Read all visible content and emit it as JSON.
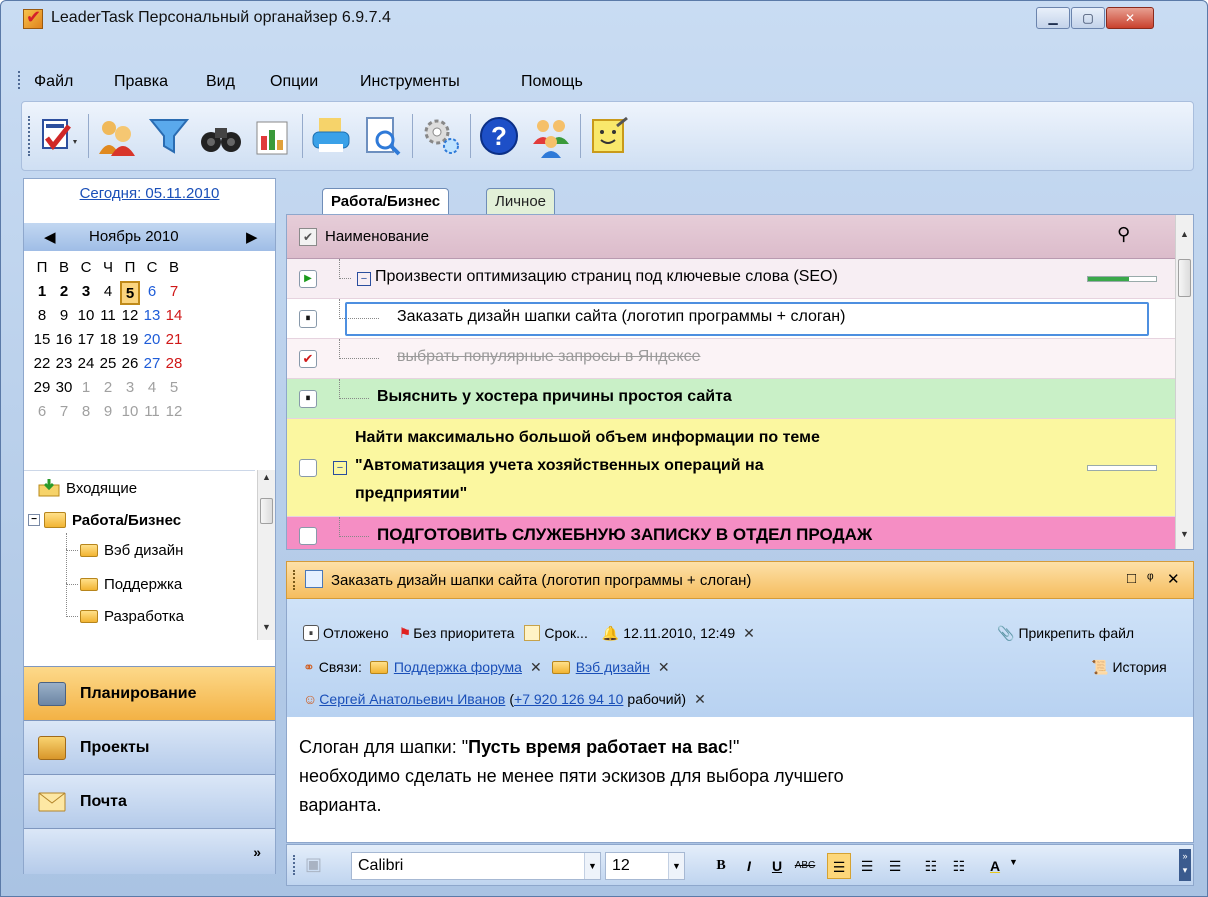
{
  "window": {
    "title": "LeaderTask Персональный органайзер 6.9.7.4"
  },
  "menu": [
    "Файл",
    "Правка",
    "Вид",
    "Опции",
    "Инструменты",
    "Помощь"
  ],
  "toolbar": {
    "icons": [
      "add-task-icon",
      "contacts-icon",
      "filter-icon",
      "binoculars-icon",
      "report-icon",
      "print-icon",
      "preview-icon",
      "settings-icon",
      "help-icon",
      "people-icon",
      "notes-icon"
    ]
  },
  "calendar": {
    "today_link": "Сегодня: 05.11.2010",
    "month": "Ноябрь 2010",
    "weekdays": [
      "П",
      "В",
      "С",
      "Ч",
      "П",
      "С",
      "В"
    ],
    "weeks": [
      [
        "1",
        "2",
        "3",
        "4",
        "5",
        "6",
        "7"
      ],
      [
        "8",
        "9",
        "10",
        "11",
        "12",
        "13",
        "14"
      ],
      [
        "15",
        "16",
        "17",
        "18",
        "19",
        "20",
        "21"
      ],
      [
        "22",
        "23",
        "24",
        "25",
        "26",
        "27",
        "28"
      ],
      [
        "29",
        "30",
        "1",
        "2",
        "3",
        "4",
        "5"
      ],
      [
        "6",
        "7",
        "8",
        "9",
        "10",
        "11",
        "12"
      ]
    ]
  },
  "folders": {
    "inbox": "Входящие",
    "group": "Работа/Бизнес",
    "items": [
      "Вэб дизайн",
      "Поддержка",
      "Разработка"
    ]
  },
  "nav": {
    "planning": "Планирование",
    "projects": "Проекты",
    "mail": "Почта",
    "more": "»"
  },
  "tabs": [
    "Работа/Бизнес",
    "Личное"
  ],
  "grid": {
    "header": "Наименование",
    "rows": [
      {
        "text": "Произвести оптимизацию страниц под ключевые слова (SEO)",
        "progress": 0.6
      },
      {
        "text": "Заказать дизайн шапки сайта (логотип программы + слоган)"
      },
      {
        "text": "выбрать популярные запросы в Яндексе"
      },
      {
        "text": "Выяснить у хостера причины простоя сайта"
      },
      {
        "text_line1": "Найти максимально большой объем информации по теме",
        "text_line2": "\"Автоматизация учета хозяйственных операций на",
        "text_line3": "предприятии\"",
        "progress": 0.0
      },
      {
        "text": "ПОДГОТОВИТЬ СЛУЖЕБНУЮ ЗАПИСКУ В ОТДЕЛ ПРОДАЖ"
      }
    ]
  },
  "detail": {
    "title": "Заказать дизайн шапки сайта (логотип программы + слоган)",
    "header_buttons": [
      "□",
      "ᵠ",
      "✕"
    ],
    "status": "Отложено",
    "priority": "Без приоритета",
    "deadline": "Срок...",
    "reminder": "12.11.2010, 12:49",
    "attach": "Прикрепить файл",
    "links_label": "Связи:",
    "link1": "Поддержка форума",
    "link2": "Вэб дизайн",
    "history": "История",
    "contact": "Сергей Анатольевич Иванов",
    "phone": "+7 920 126 94 10",
    "phone_type": "рабочий)",
    "close_x": "✕",
    "desc_line1_pre": "Слоган для шапки: \"",
    "desc_line1_bold": "Пусть время работает на вас",
    "desc_line1_post": "!\"",
    "desc_line2": "необходимо сделать не менее пяти эскизов для выбора лучшего",
    "desc_line3": "варианта."
  },
  "format_bar": {
    "font": "Calibri",
    "size": "12",
    "bold": "B",
    "italic": "I",
    "underline": "U",
    "strike": "ABC",
    "color_letter": "A"
  }
}
